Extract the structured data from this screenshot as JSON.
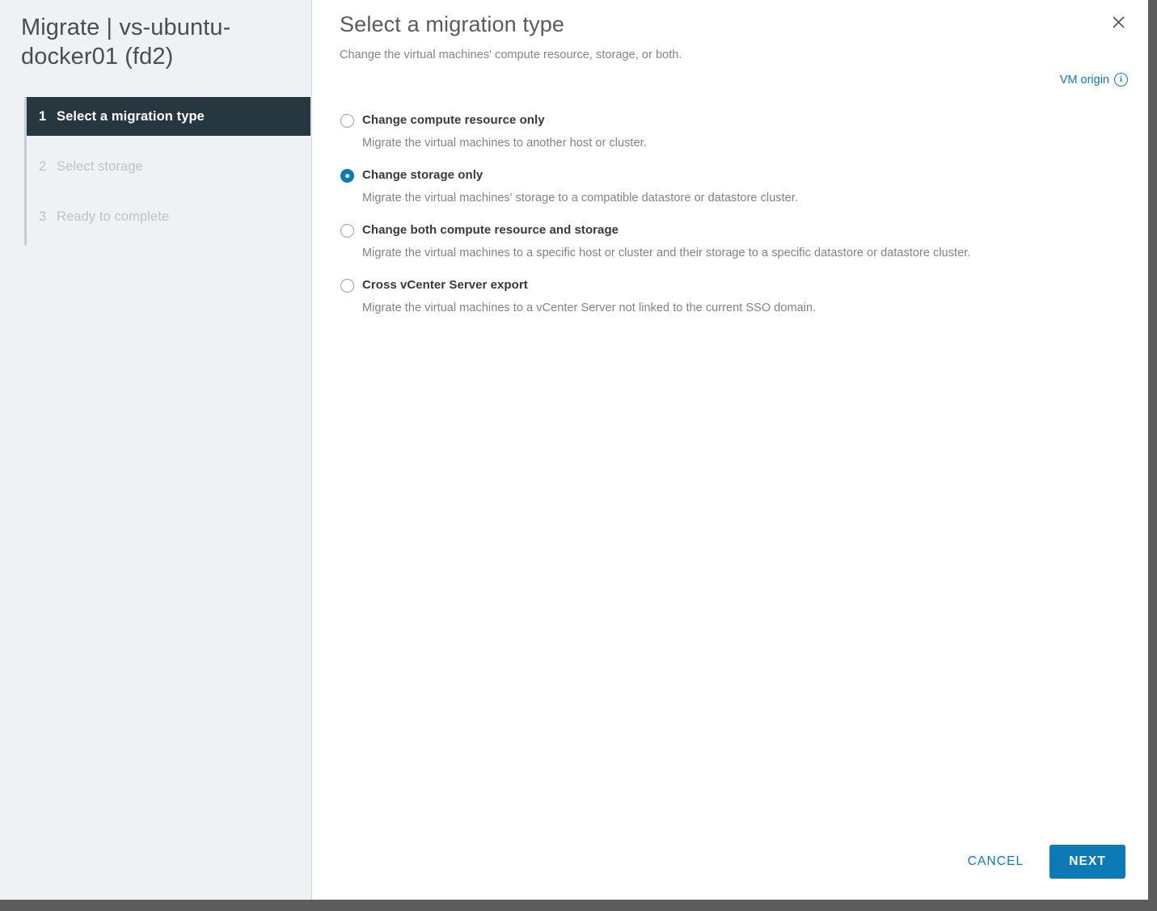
{
  "sidebar": {
    "title": "Migrate | vs-ubuntu-docker01 (fd2)",
    "steps": [
      {
        "num": "1",
        "label": "Select a migration type",
        "state": "active"
      },
      {
        "num": "2",
        "label": "Select storage",
        "state": "inactive"
      },
      {
        "num": "3",
        "label": "Ready to complete",
        "state": "inactive"
      }
    ]
  },
  "header": {
    "title": "Select a migration type",
    "subtitle": "Change the virtual machines' compute resource, storage, or both.",
    "close_icon": "close-icon",
    "vm_origin_label": "VM origin",
    "vm_origin_info_glyph": "i"
  },
  "options": [
    {
      "label": "Change compute resource only",
      "description": "Migrate the virtual machines to another host or cluster.",
      "selected": false
    },
    {
      "label": "Change storage only",
      "description": "Migrate the virtual machines' storage to a compatible datastore or datastore cluster.",
      "selected": true
    },
    {
      "label": "Change both compute resource and storage",
      "description": "Migrate the virtual machines to a specific host or cluster and their storage to a specific datastore or datastore cluster.",
      "selected": false
    },
    {
      "label": "Cross vCenter Server export",
      "description": "Migrate the virtual machines to a vCenter Server not linked to the current SSO domain.",
      "selected": false
    }
  ],
  "footer": {
    "cancel_label": "CANCEL",
    "next_label": "NEXT"
  },
  "colors": {
    "accent": "#0c7ab5",
    "active_step_bg": "#27373f",
    "sidebar_bg": "#eef2f5",
    "window_chrome": "#5d5d5d"
  }
}
